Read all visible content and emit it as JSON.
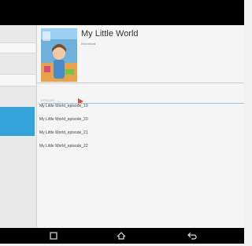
{
  "app": {
    "title": "My Little World",
    "category": "Educational"
  },
  "episodes_section": {
    "label": "EPISODI",
    "items": [
      "My Little World_episode_19",
      "My Little World_episode_20",
      "My Little World_episode_21",
      "My Little World_episode_22"
    ]
  },
  "navigation": {
    "back": "back-icon",
    "home": "home-icon",
    "recent": "recent-apps-icon"
  },
  "colors": {
    "accent": "#33a2d8",
    "corner_marker": "#e44b3d",
    "status_bar": "#000000"
  }
}
